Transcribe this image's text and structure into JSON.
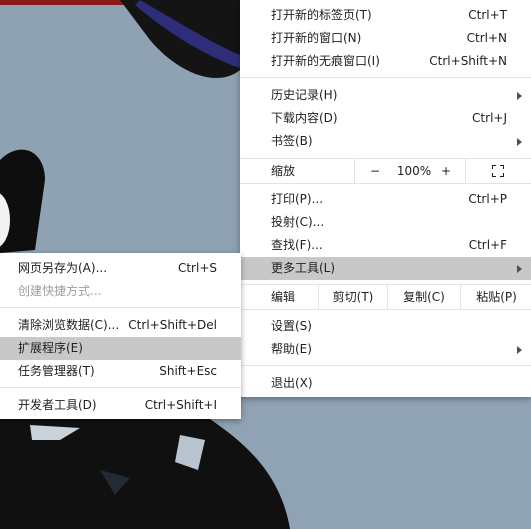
{
  "main_menu": {
    "new_tab": {
      "label": "打开新的标签页(T)",
      "shortcut": "Ctrl+T"
    },
    "new_window": {
      "label": "打开新的窗口(N)",
      "shortcut": "Ctrl+N"
    },
    "new_incognito": {
      "label": "打开新的无痕窗口(I)",
      "shortcut": "Ctrl+Shift+N"
    },
    "history": {
      "label": "历史记录(H)"
    },
    "downloads": {
      "label": "下载内容(D)",
      "shortcut": "Ctrl+J"
    },
    "bookmarks": {
      "label": "书签(B)"
    },
    "zoom": {
      "label": "缩放",
      "minus": "−",
      "value": "100%",
      "plus": "+",
      "fullscreen_icon": "fullscreen-icon"
    },
    "print": {
      "label": "打印(P)...",
      "shortcut": "Ctrl+P"
    },
    "cast": {
      "label": "投射(C)..."
    },
    "find": {
      "label": "查找(F)...",
      "shortcut": "Ctrl+F"
    },
    "more_tools": {
      "label": "更多工具(L)"
    },
    "edit": {
      "label": "编辑",
      "cut": "剪切(T)",
      "copy": "复制(C)",
      "paste": "粘贴(P)"
    },
    "settings": {
      "label": "设置(S)"
    },
    "help": {
      "label": "帮助(E)"
    },
    "exit": {
      "label": "退出(X)"
    }
  },
  "sub_menu": {
    "save_page": {
      "label": "网页另存为(A)...",
      "shortcut": "Ctrl+S"
    },
    "create_shortcut": {
      "label": "创建快捷方式..."
    },
    "clear_data": {
      "label": "清除浏览数据(C)...",
      "shortcut": "Ctrl+Shift+Del"
    },
    "extensions": {
      "label": "扩展程序(E)"
    },
    "task_manager": {
      "label": "任务管理器(T)",
      "shortcut": "Shift+Esc"
    },
    "dev_tools": {
      "label": "开发者工具(D)",
      "shortcut": "Ctrl+Shift+I"
    }
  },
  "colors": {
    "highlight": "#c8c8c8",
    "separator": "#e3e3e3",
    "text": "#202124",
    "disabled": "#9aa0a6"
  }
}
